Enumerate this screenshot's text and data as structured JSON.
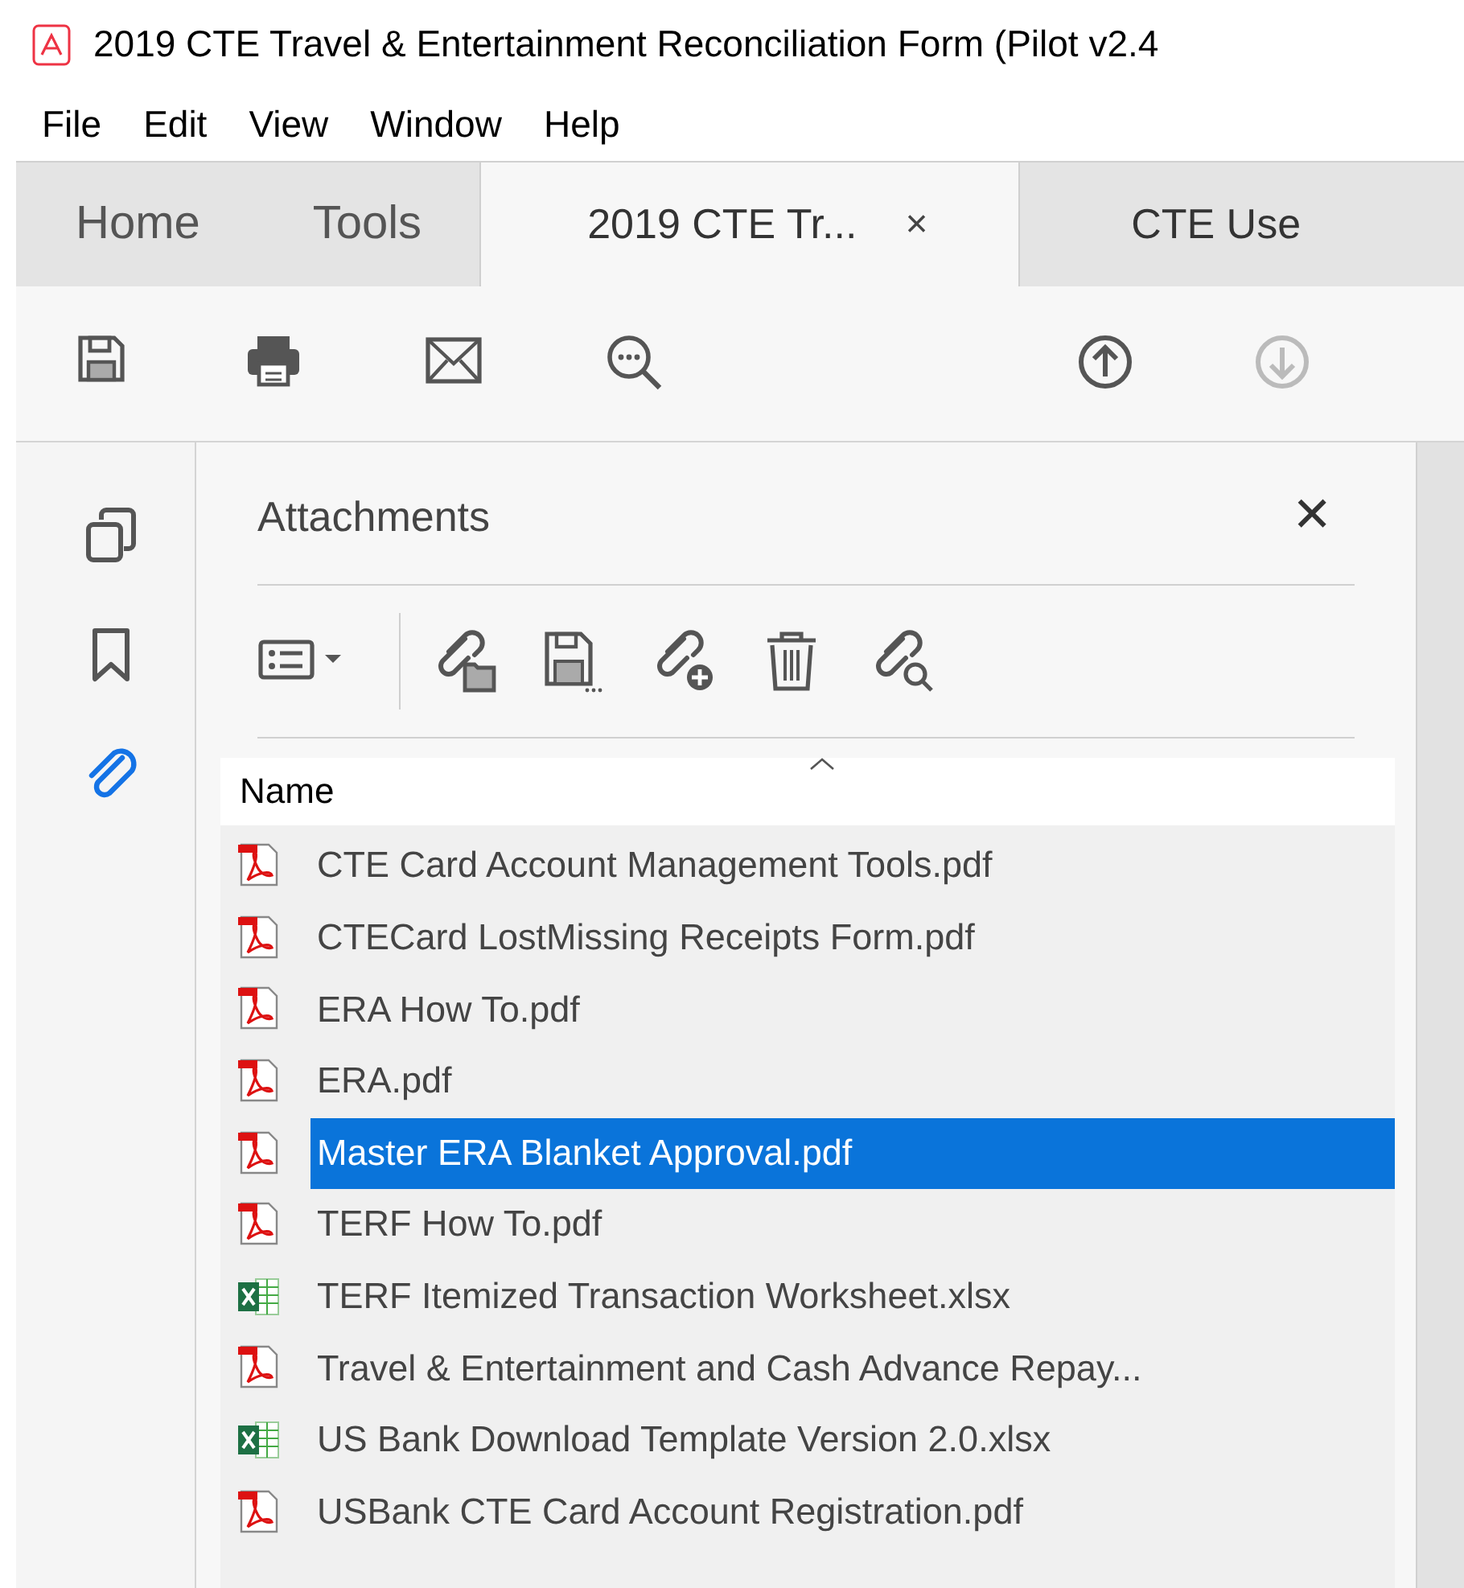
{
  "window": {
    "title": "2019 CTE Travel & Entertainment Reconciliation Form (Pilot v2.4"
  },
  "menu": [
    "File",
    "Edit",
    "View",
    "Window",
    "Help"
  ],
  "tabs": [
    {
      "label": "Home",
      "kind": "plain",
      "selected": false
    },
    {
      "label": "Tools",
      "kind": "plain",
      "selected": false
    },
    {
      "label": "2019 CTE Tr...",
      "kind": "document",
      "close": "×",
      "selected": true
    },
    {
      "label": "CTE Use",
      "kind": "document",
      "selected": false
    }
  ],
  "toolbar": [
    {
      "kind": "save",
      "disabled": false
    },
    {
      "kind": "print",
      "disabled": false
    },
    {
      "kind": "mail",
      "disabled": false
    },
    {
      "kind": "find",
      "disabled": false
    },
    {
      "kind": "up",
      "disabled": false
    },
    {
      "kind": "down",
      "disabled": true
    }
  ],
  "rail": [
    {
      "kind": "pages",
      "selected": false
    },
    {
      "kind": "bookmark",
      "selected": false
    },
    {
      "kind": "attachment",
      "selected": true
    }
  ],
  "panel": {
    "title": "Attachments",
    "close": "✕",
    "tools": [
      {
        "kind": "options"
      },
      {
        "kind": "open"
      },
      {
        "kind": "save"
      },
      {
        "kind": "add"
      },
      {
        "kind": "delete"
      },
      {
        "kind": "search"
      }
    ],
    "column": "Name",
    "rows": [
      {
        "name": "CTE Card Account Management Tools.pdf",
        "kind": "pdf",
        "selected": false
      },
      {
        "name": "CTECard LostMissing Receipts Form.pdf",
        "kind": "pdf",
        "selected": false
      },
      {
        "name": "ERA How To.pdf",
        "kind": "pdf",
        "selected": false
      },
      {
        "name": "ERA.pdf",
        "kind": "pdf",
        "selected": false
      },
      {
        "name": "Master ERA Blanket Approval.pdf",
        "kind": "pdf",
        "selected": true
      },
      {
        "name": "TERF How To.pdf",
        "kind": "pdf",
        "selected": false
      },
      {
        "name": "TERF Itemized Transaction Worksheet.xlsx",
        "kind": "xlsx",
        "selected": false
      },
      {
        "name": "Travel & Entertainment and Cash Advance Repay...",
        "kind": "pdf",
        "selected": false
      },
      {
        "name": "US Bank Download Template Version 2.0.xlsx",
        "kind": "xlsx",
        "selected": false
      },
      {
        "name": "USBank CTE Card Account Registration.pdf",
        "kind": "pdf",
        "selected": false
      }
    ]
  }
}
